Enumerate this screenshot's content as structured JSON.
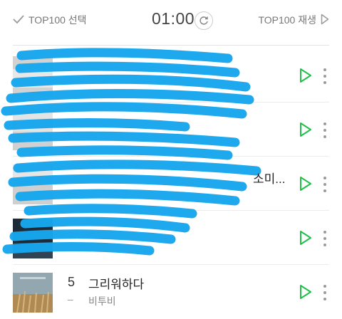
{
  "header": {
    "select_label": "TOP100 선택",
    "timer": "01:00",
    "play_label": "TOP100 재생"
  },
  "colors": {
    "accent": "#1fbf4a",
    "scribble": "#17a7ee"
  },
  "songs": [
    {
      "rank": "",
      "change": "",
      "title": "",
      "artist": "",
      "redacted": true
    },
    {
      "rank": "",
      "change": "",
      "title": "",
      "artist": "",
      "redacted": true
    },
    {
      "rank": "",
      "change": "",
      "title": "",
      "artist": "",
      "redacted": true
    },
    {
      "rank": "",
      "change": "",
      "title": "",
      "artist": "",
      "redacted": true
    },
    {
      "rank": "5",
      "change": "–",
      "title": "그리워하다",
      "artist": "비투비",
      "redacted": false
    }
  ]
}
